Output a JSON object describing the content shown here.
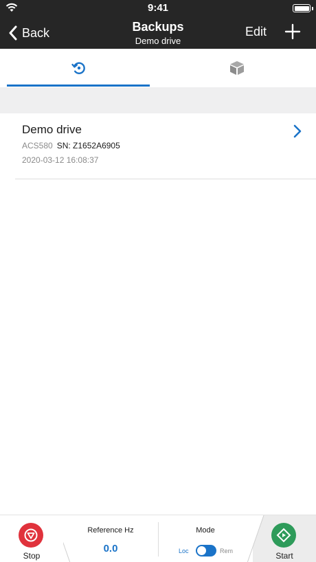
{
  "status_bar": {
    "time": "9:41"
  },
  "nav": {
    "back_label": "Back",
    "title": "Backups",
    "subtitle": "Demo drive",
    "edit_label": "Edit"
  },
  "tabs": [
    {
      "icon": "restore-icon",
      "active": true
    },
    {
      "icon": "package-icon",
      "active": false
    }
  ],
  "backups": [
    {
      "name": "Demo drive",
      "model": "ACS580",
      "serial": "SN: Z1652A6905",
      "date": "2020-03-12 16:08:37"
    }
  ],
  "control_bar": {
    "stop_label": "Stop",
    "reference_title": "Reference Hz",
    "reference_value": "0.0",
    "mode_title": "Mode",
    "mode_loc": "Loc",
    "mode_rem": "Rem",
    "start_label": "Start"
  },
  "colors": {
    "header": "#262626",
    "accent": "#1a73c8",
    "stop": "#e0323c",
    "start": "#2e9b5a"
  }
}
